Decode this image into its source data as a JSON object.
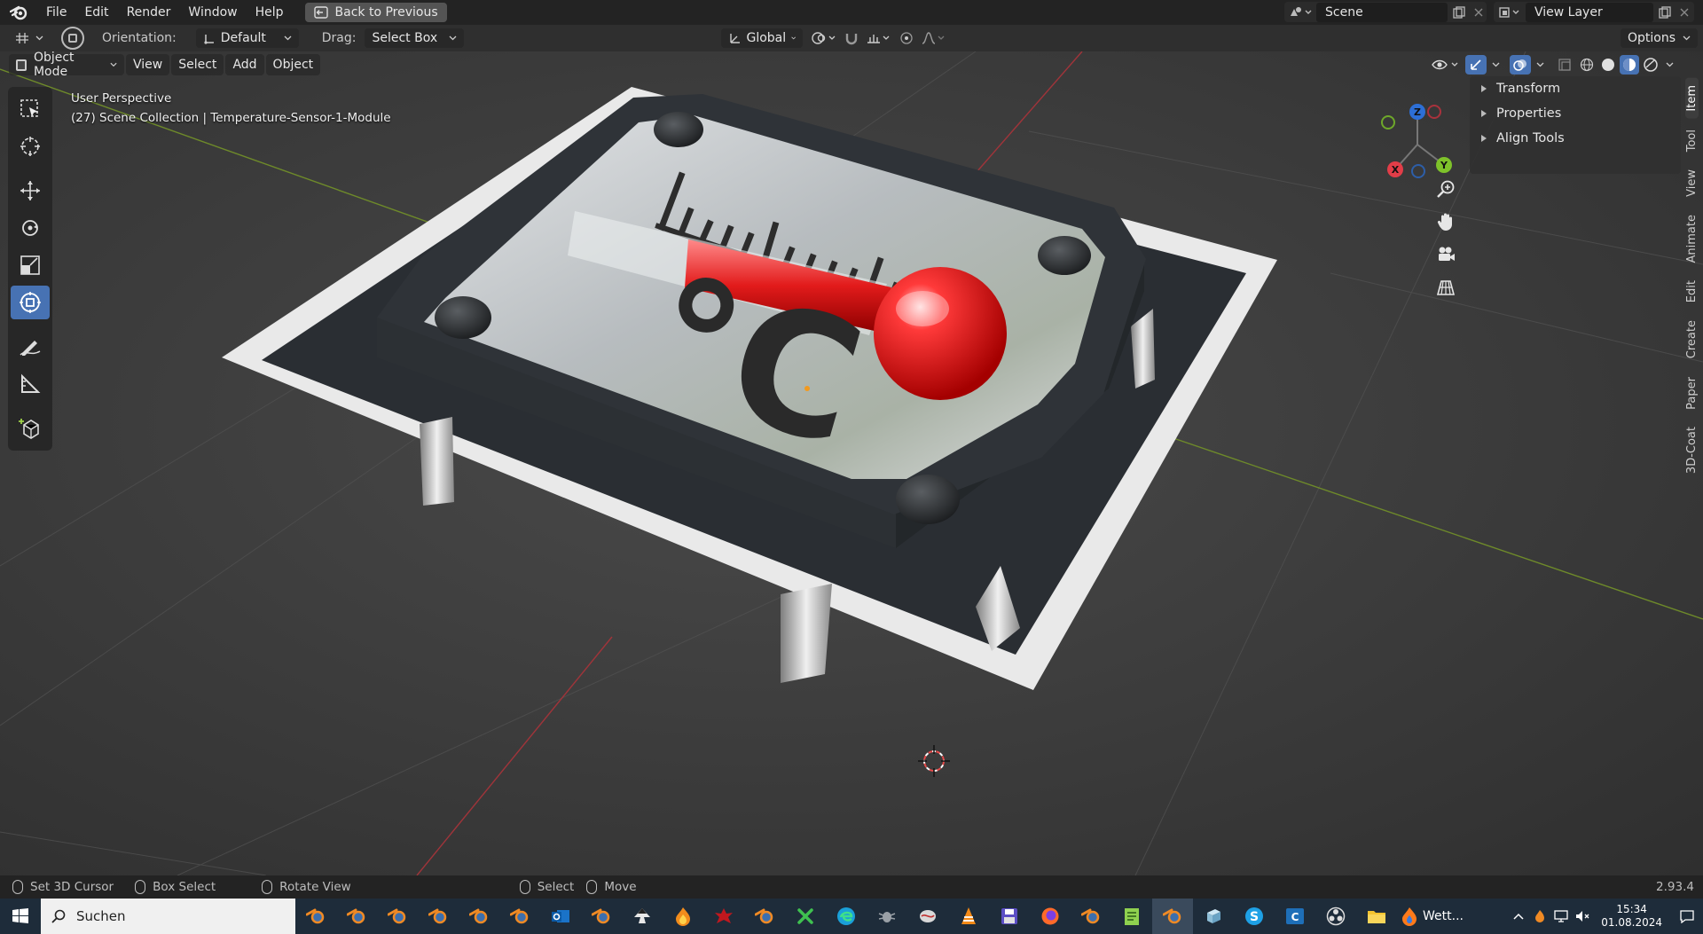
{
  "menubar": {
    "items": [
      "File",
      "Edit",
      "Render",
      "Window",
      "Help"
    ],
    "back_button": "Back to Previous",
    "scene_label": "Scene",
    "view_layer_label": "View Layer"
  },
  "header": {
    "orientation_label": "Orientation:",
    "orientation_value": "Default",
    "drag_label": "Drag:",
    "drag_value": "Select Box",
    "transform_orientation": "Global",
    "options_label": "Options"
  },
  "viewport": {
    "mode": "Object Mode",
    "menu": [
      "View",
      "Select",
      "Add",
      "Object"
    ],
    "perspective": "User Perspective",
    "collection_info": "(27) Scene Collection | Temperature-Sensor-1-Module",
    "gizmo_axes": {
      "x": "X",
      "y": "Y",
      "z": "Z"
    }
  },
  "npanel": {
    "items": [
      "Transform",
      "Properties",
      "Align Tools"
    ],
    "tabs": [
      "Item",
      "Tool",
      "View",
      "Animate",
      "Edit",
      "Create",
      "Paper",
      "3D-Coat"
    ],
    "active_tab": "Item"
  },
  "statusbar": {
    "left": "Set 3D Cursor",
    "box_select": "Box Select",
    "rotate": "Rotate View",
    "select": "Select",
    "move": "Move",
    "version": "2.93.4"
  },
  "taskbar": {
    "search_placeholder": "Suchen",
    "weather_label": "Wett...",
    "time": "15:34",
    "date": "01.08.2024"
  },
  "scene_art": {
    "unit_symbol": "°C"
  },
  "colors": {
    "accent": "#4772b3",
    "x_axis": "#e8474e",
    "y_axis": "#8bd02b",
    "z_axis": "#3a8ee6"
  }
}
